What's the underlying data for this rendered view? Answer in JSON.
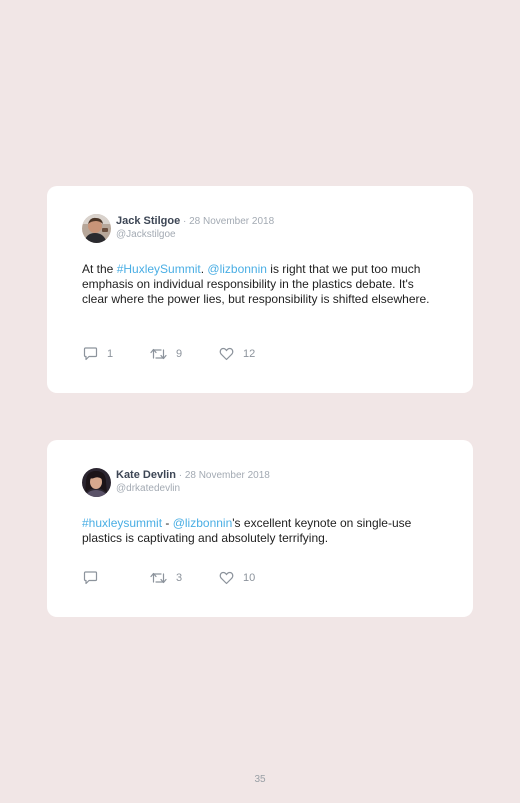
{
  "tweets": [
    {
      "name": "Jack Stilgoe",
      "separator": " · ",
      "date": "28 November 2018",
      "handle": "@Jackstilgoe",
      "text_parts": {
        "p0": "At the ",
        "p1": "#HuxleySummit",
        "p2": ". ",
        "p3": "@lizbonnin",
        "p4": " is right that we put too much emphasis on individual responsibility in the plastics debate. It's clear where the power lies, but responsibility is shifted elsewhere."
      },
      "replies": "1",
      "retweets": "9",
      "likes": "12"
    },
    {
      "name": "Kate Devlin",
      "separator": " · ",
      "date": "28 November 2018",
      "handle": "@drkatedevlin",
      "text_parts": {
        "p0": "",
        "p1": "#huxleysummit",
        "p2": " - ",
        "p3": "@lizbonnin",
        "p4": "'s excellent keynote on single-use plastics is captivating and absolutely terrifying."
      },
      "replies": "",
      "retweets": "3",
      "likes": "10"
    }
  ],
  "icons": {
    "reply": "reply-icon",
    "retweet": "retweet-icon",
    "like": "heart-icon"
  },
  "colors": {
    "background": "#f1e6e6",
    "card": "#ffffff",
    "link": "#4aaee4",
    "muted": "#a3aab3"
  },
  "page_number": "35"
}
